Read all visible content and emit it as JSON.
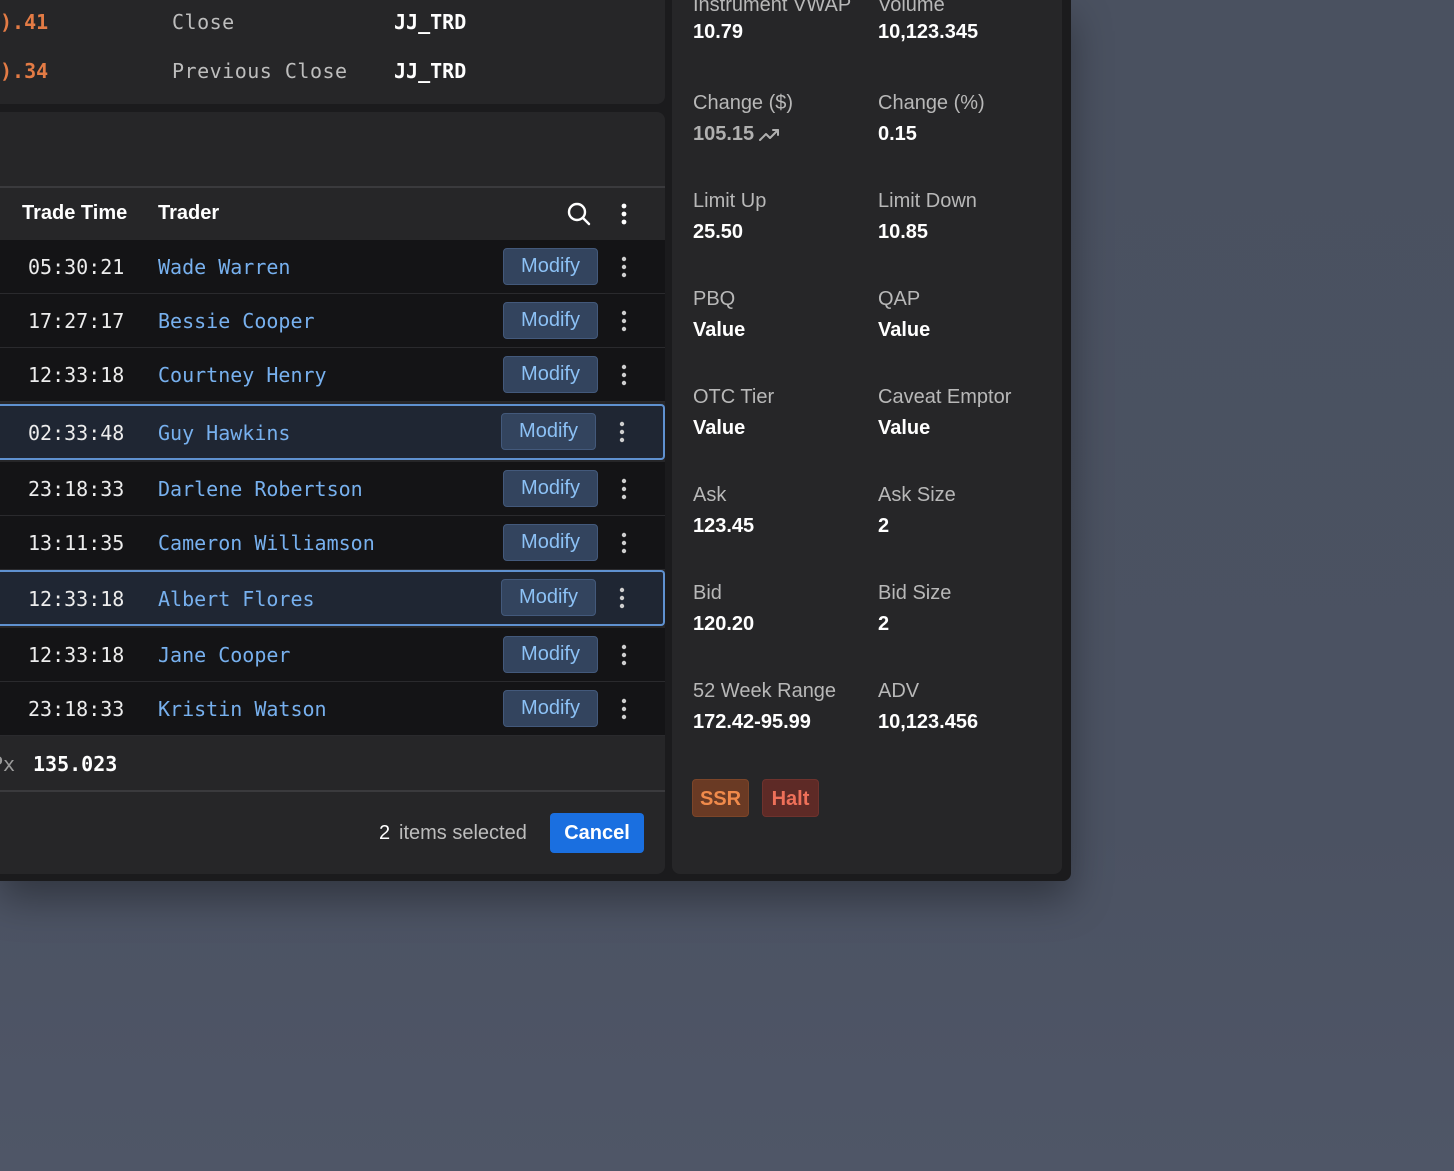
{
  "quote": {
    "rows": [
      {
        "value": ").41",
        "label": "Close",
        "instrument": "JJ_TRD"
      },
      {
        "value": ").34",
        "label": "Previous Close",
        "instrument": "JJ_TRD"
      }
    ]
  },
  "trades": {
    "columns": {
      "trade_time": "Trade Time",
      "trader": "Trader"
    },
    "modify_label": "Modify",
    "rows": [
      {
        "time": "05:30:21",
        "trader": "Wade Warren",
        "selected": false
      },
      {
        "time": "17:27:17",
        "trader": "Bessie Cooper",
        "selected": false
      },
      {
        "time": "12:33:18",
        "trader": "Courtney Henry",
        "selected": false
      },
      {
        "time": "02:33:48",
        "trader": "Guy Hawkins",
        "selected": true
      },
      {
        "time": "23:18:33",
        "trader": "Darlene Robertson",
        "selected": false
      },
      {
        "time": "13:11:35",
        "trader": "Cameron Williamson",
        "selected": false
      },
      {
        "time": "12:33:18",
        "trader": "Albert Flores",
        "selected": true
      },
      {
        "time": "12:33:18",
        "trader": "Jane Cooper",
        "selected": false
      },
      {
        "time": "23:18:33",
        "trader": "Kristin Watson",
        "selected": false
      }
    ],
    "px_label": "Px",
    "px_value": "135.023",
    "selection": {
      "count": "2",
      "text": "items selected",
      "cancel_label": "Cancel"
    }
  },
  "details": {
    "fields": [
      {
        "label": "Instrument VWAP",
        "value": "10.79"
      },
      {
        "label": "Volume",
        "value": "10,123.345"
      },
      {
        "label": "Change ($)",
        "value": "105.15",
        "muted": true,
        "trend_icon": "trending-up-icon"
      },
      {
        "label": "Change (%)",
        "value": "0.15"
      },
      {
        "label": "Limit Up",
        "value": "25.50"
      },
      {
        "label": "Limit Down",
        "value": "10.85"
      },
      {
        "label": "PBQ",
        "value": "Value"
      },
      {
        "label": "QAP",
        "value": "Value"
      },
      {
        "label": "OTC Tier",
        "value": "Value"
      },
      {
        "label": "Caveat Emptor",
        "value": "Value"
      },
      {
        "label": "Ask",
        "value": "123.45"
      },
      {
        "label": "Ask Size",
        "value": "2"
      },
      {
        "label": "Bid",
        "value": "120.20"
      },
      {
        "label": "Bid Size",
        "value": "2"
      },
      {
        "label": "52 Week Range",
        "value": "172.42-95.99"
      },
      {
        "label": "ADV",
        "value": "10,123.456"
      }
    ],
    "badges": {
      "ssr": "SSR",
      "halt": "Halt"
    }
  },
  "colors": {
    "accent_blue": "#1a6fe0",
    "trader_link": "#77b0ee",
    "selected_border": "#5f91d0",
    "quote_value": "#e37b45",
    "ssr": "#f08a4b",
    "halt": "#ee7059"
  }
}
